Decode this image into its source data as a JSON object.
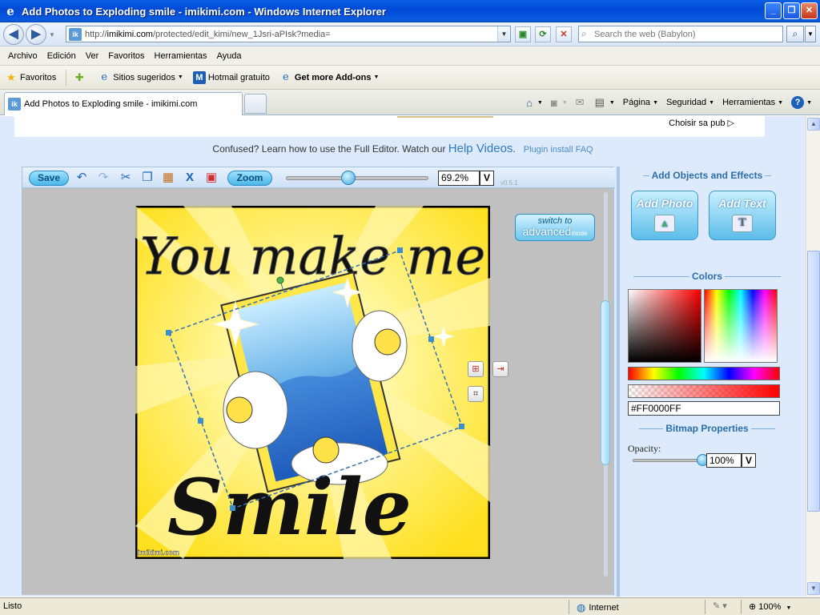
{
  "window": {
    "title": "Add Photos to Exploding smile - imikimi.com - Windows Internet Explorer",
    "btn_min": "_",
    "btn_max": "❐",
    "btn_close": "✕"
  },
  "addressbar": {
    "url_prefix": "http://",
    "url_domain": "imikimi.com",
    "url_rest": "/protected/edit_kimi/new_1Jsri-aPIsk?media=",
    "search_placeholder": "Search the web (Babylon)"
  },
  "menu": [
    "Archivo",
    "Edición",
    "Ver",
    "Favoritos",
    "Herramientas",
    "Ayuda"
  ],
  "favorites": {
    "label": "Favoritos",
    "items": [
      "Sitios sugeridos",
      "Hotmail gratuito",
      "Get more Add-ons"
    ]
  },
  "tab": {
    "title": "Add Photos to Exploding smile - imikimi.com",
    "favicon": "ik"
  },
  "commandbar": {
    "page": "Página",
    "security": "Seguridad",
    "tools": "Herramientas",
    "help": "?"
  },
  "page": {
    "ad_text": "Choisir sa pub",
    "help_prefix": "Confused? Learn how to use the Full Editor. Watch our ",
    "help_link": "Help Videos",
    "help_dot": ".",
    "plugin_faq": "Plugin install FAQ"
  },
  "editor": {
    "save": "Save",
    "zoom_btn": "Zoom",
    "zoom_value": "69.2%",
    "zoom_level": 0.44,
    "zoom_dropdown": "V",
    "version": "v0.5.1",
    "switch_line1": "switch to",
    "switch_line2": "advanced",
    "switch_line3": "mode",
    "canvas_text_top": "You make me",
    "canvas_text_bottom": "Smile",
    "watermark": "imikimi.com"
  },
  "panel": {
    "add_objects": "Add Objects and Effects",
    "add_photo": "Add Photo",
    "add_text": "Add Text",
    "colors": "Colors",
    "hex": "#FF0000FF",
    "bitmap": "Bitmap Properties",
    "opacity_label": "Opacity:",
    "opacity_value": "100%",
    "opacity_level": 1.0,
    "opacity_dropdown": "V"
  },
  "status": {
    "left": "Listo",
    "zone": "Internet",
    "zoom": "100%"
  },
  "colors": {
    "titlebar": "#0049d6",
    "panel_bg": "#dceafb",
    "accent": "#2f7bbf",
    "canvas_yellow": "#ffe838"
  }
}
